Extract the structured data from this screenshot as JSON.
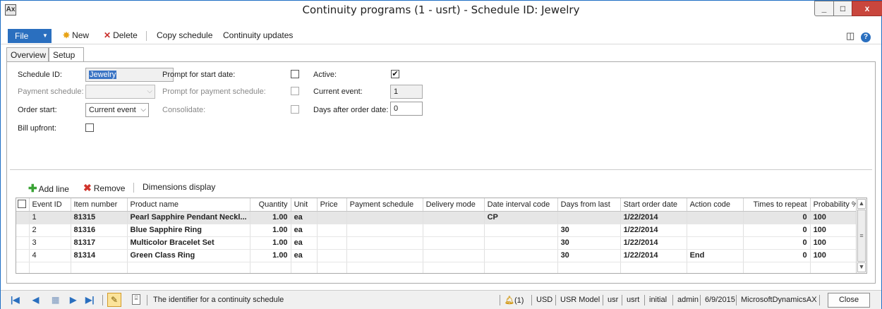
{
  "window": {
    "title": "Continuity programs (1 - usrt) - Schedule ID: Jewelry",
    "app_icon": "Ax",
    "controls": {
      "minimize": "_",
      "maximize": "□",
      "close": "x"
    }
  },
  "actionpane": {
    "file_label": "File",
    "new_label": "New",
    "delete_label": "Delete",
    "copy_schedule_label": "Copy schedule",
    "continuity_updates_label": "Continuity updates"
  },
  "tabs": [
    {
      "label": "Overview"
    },
    {
      "label": "Setup"
    }
  ],
  "setup": {
    "schedule_id_label": "Schedule ID:",
    "schedule_id_value": "Jewelry",
    "payment_schedule_label": "Payment schedule:",
    "payment_schedule_value": "",
    "order_start_label": "Order start:",
    "order_start_value": "Current event",
    "bill_upfront_label": "Bill upfront:",
    "bill_upfront_checked": false,
    "prompt_start_date_label": "Prompt for start date:",
    "prompt_start_date_checked": false,
    "prompt_payment_schedule_label": "Prompt for payment schedule:",
    "prompt_payment_schedule_checked": false,
    "consolidate_label": "Consolidate:",
    "consolidate_checked": false,
    "active_label": "Active:",
    "active_checked": true,
    "active_mark": "✔",
    "current_event_label": "Current event:",
    "current_event_value": "1",
    "days_after_order_label": "Days after order date:",
    "days_after_order_value": "0"
  },
  "grid_toolbar": {
    "add_line_label": "Add line",
    "remove_label": "Remove",
    "dimensions_display_label": "Dimensions display"
  },
  "grid": {
    "columns": [
      "Event ID",
      "Item number",
      "Product name",
      "Quantity",
      "Unit",
      "Price",
      "Payment schedule",
      "Delivery mode",
      "Date interval code",
      "Days from last",
      "Start order date",
      "Action code",
      "Times to repeat",
      "Probability %"
    ],
    "rows": [
      [
        "1",
        "81315",
        "Pearl Sapphire Pendant Neckl...",
        "1.00",
        "ea",
        "",
        "",
        "",
        "CP",
        "",
        "1/22/2014",
        "",
        "0",
        "100"
      ],
      [
        "2",
        "81316",
        "Blue Sapphire Ring",
        "1.00",
        "ea",
        "",
        "",
        "",
        "",
        "30",
        "1/22/2014",
        "",
        "0",
        "100"
      ],
      [
        "3",
        "81317",
        "Multicolor Bracelet Set",
        "1.00",
        "ea",
        "",
        "",
        "",
        "",
        "30",
        "1/22/2014",
        "",
        "0",
        "100"
      ],
      [
        "4",
        "81314",
        "Green Class Ring",
        "1.00",
        "ea",
        "",
        "",
        "",
        "",
        "30",
        "1/22/2014",
        "End",
        "0",
        "100"
      ]
    ],
    "selected_row": 0
  },
  "statusbar": {
    "help_text": "The identifier for a continuity schedule",
    "alerts": "(1)",
    "currency": "USD",
    "model": "USR Model",
    "layer": "usr",
    "company": "usrt",
    "environment": "initial",
    "user": "admin",
    "date": "6/9/2015",
    "server": "MicrosoftDynamicsAX",
    "close_label": "Close"
  },
  "colors": {
    "accent": "#2a6fbf",
    "close_red": "#c9463d",
    "selection": "#3a74c4"
  },
  "icons": [
    "app-icon",
    "new-icon",
    "delete-icon",
    "layout-icon",
    "help-icon",
    "add-icon",
    "remove-icon",
    "first-icon",
    "prev-icon",
    "grid-icon",
    "next-icon",
    "last-icon",
    "edit-icon",
    "attachment-icon",
    "bell-icon"
  ]
}
